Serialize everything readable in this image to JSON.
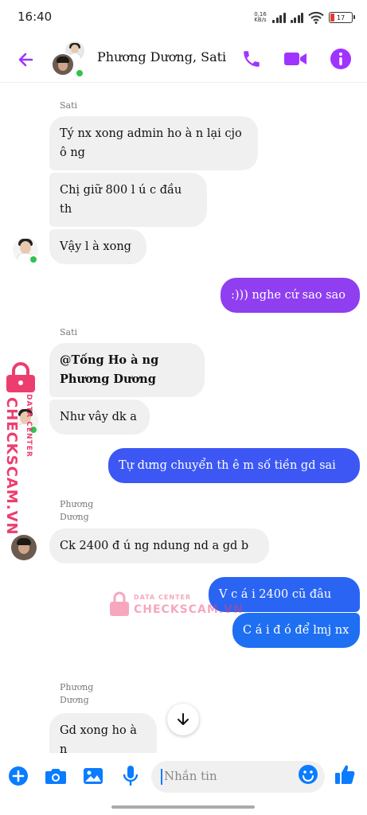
{
  "status_bar": {
    "time": "16:40",
    "net_speed_value": "0,16",
    "net_speed_unit": "KB/s",
    "battery_level": "17"
  },
  "header": {
    "title": "Phương Dương, Sati",
    "accent_color": "#a033ff",
    "icons": [
      "back-arrow-icon",
      "phone-icon",
      "video-icon",
      "info-icon"
    ]
  },
  "messages": [
    {
      "sender": "Sati",
      "direction": "in",
      "text": "Tý nx xong admin ho à n lại cjo ô ng"
    },
    {
      "direction": "in",
      "text": "Chị giữ 800 l ú c đầu th"
    },
    {
      "direction": "in",
      "text": "Vậy l à  xong"
    },
    {
      "direction": "out",
      "text": ":))) nghe cứ sao sao"
    },
    {
      "sender": "Sati",
      "direction": "in",
      "text": "@Tống Ho à ng Phương Dương",
      "bold": true
    },
    {
      "direction": "in",
      "text": "Như vây dk a"
    },
    {
      "direction": "out",
      "text": "Tự dưng chuyển th ê m số tiền gd sai"
    },
    {
      "sender": "Phương Dương",
      "direction": "in",
      "text": "Ck 2400 đ ú ng ndung nd a gd b"
    },
    {
      "direction": "out",
      "text": "V c á i 2400 cũ đâu"
    },
    {
      "direction": "out",
      "text": "C á i đ ó để lmj nx"
    },
    {
      "sender": "Phương Dương",
      "direction": "in",
      "text": "Gd xong ho à n"
    }
  ],
  "watermark": {
    "brand": "CHECKSCAM.VN",
    "sub": "DATA CENTER",
    "color": "#ec3e6e"
  },
  "composer": {
    "placeholder": "Nhắn tin",
    "icons": [
      "plus-icon",
      "camera-icon",
      "gallery-icon",
      "microphone-icon",
      "emoji-icon",
      "like-icon"
    ]
  },
  "colors": {
    "outgoing_top": "#9b3cf2",
    "outgoing_bottom": "#1e6ff2",
    "incoming": "#f0f0f0",
    "messenger_blue": "#0a7cff"
  }
}
